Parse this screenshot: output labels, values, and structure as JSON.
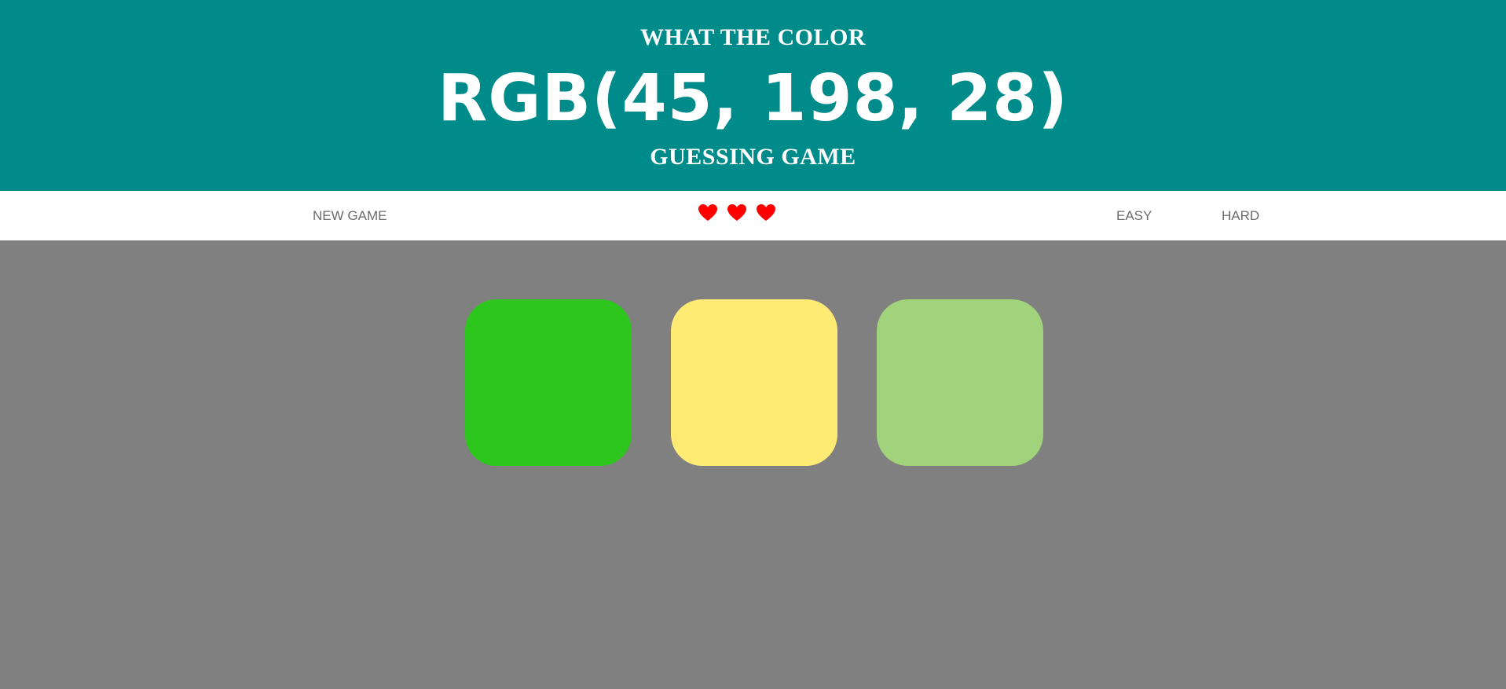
{
  "header": {
    "title_top": "WHAT THE COLOR",
    "rgb_value": "RGB(45, 198, 28)",
    "title_bottom": "GUESSING GAME",
    "background_color": "#008b8b"
  },
  "navbar": {
    "new_game_label": "NEW GAME",
    "easy_label": "EASY",
    "hard_label": "HARD",
    "lives": {
      "remaining": 3,
      "icon": "heart-icon",
      "color": "#ff0000"
    }
  },
  "board": {
    "background_color": "#808080",
    "squares": [
      {
        "color": "#2dc61c"
      },
      {
        "color": "#ffeb74"
      },
      {
        "color": "#a0d37b"
      }
    ]
  }
}
